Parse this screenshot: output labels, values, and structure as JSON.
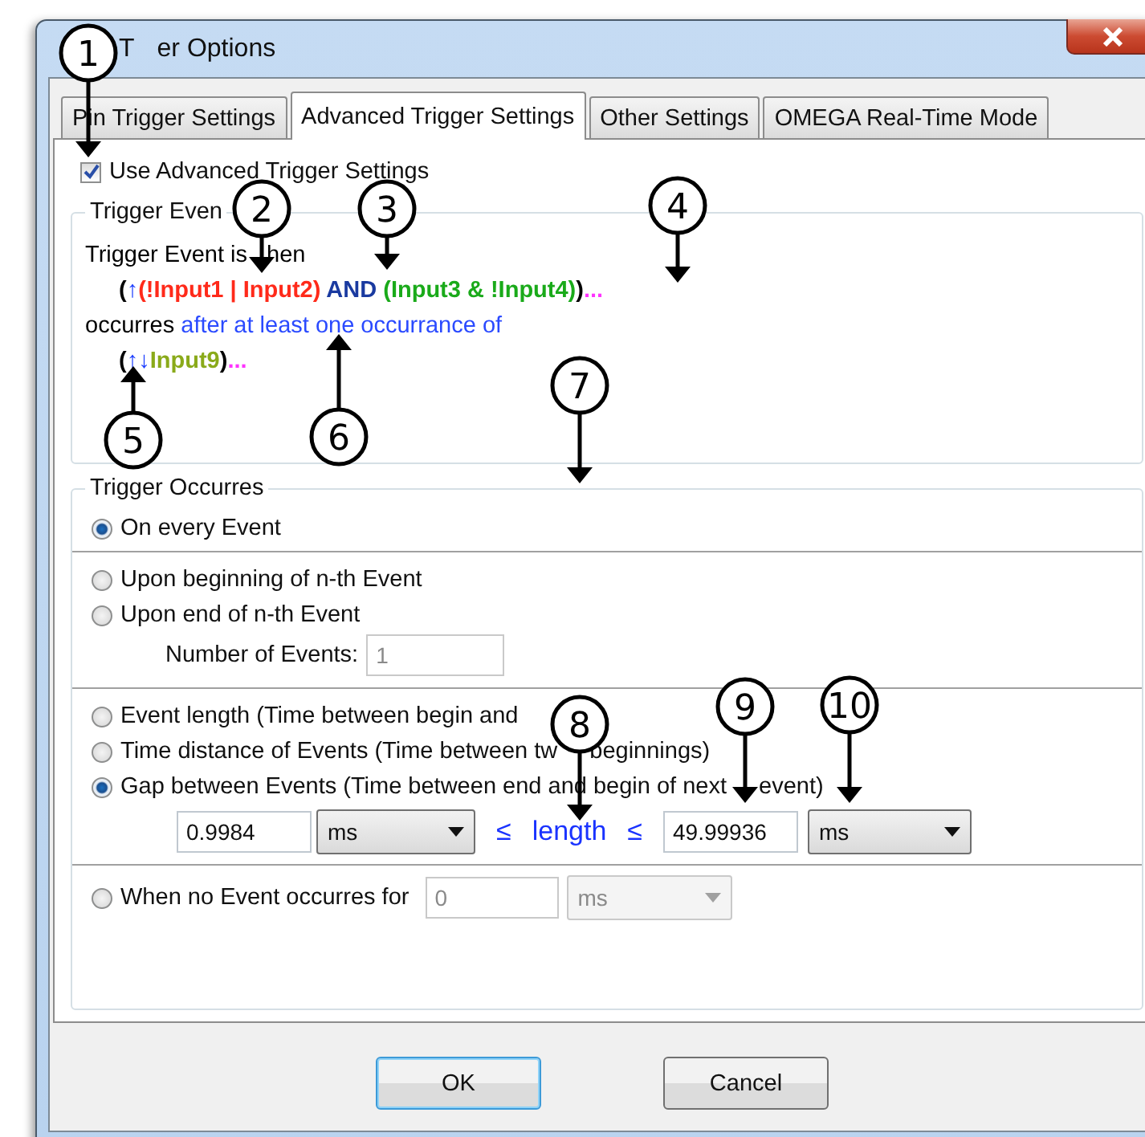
{
  "window": {
    "title_parts": [
      "T",
      "er Options"
    ]
  },
  "tabs": [
    {
      "label": "Pin Trigger Settings",
      "selected": false
    },
    {
      "label": "Advanced Trigger Settings",
      "selected": true
    },
    {
      "label": "Other Settings",
      "selected": false
    },
    {
      "label": "OMEGA Real-Time Mode",
      "selected": false
    }
  ],
  "use_advanced": {
    "label": "Use Advanced Trigger Settings",
    "checked": true
  },
  "trigger_event": {
    "legend": "Trigger Even",
    "lines": [
      {
        "kind": "split",
        "segments": [
          {
            "text": "Trigger Event is",
            "color": "#000000"
          },
          {
            "text": "hen",
            "color": "#000000"
          }
        ]
      },
      {
        "kind": "formula",
        "segments": [
          {
            "text": "(",
            "color": "#000000"
          },
          {
            "text": "↑",
            "color": "#1a3cff"
          },
          {
            "text": "(!Input1 | Input2)",
            "color": "#ff2a1a"
          },
          {
            "text": " AND ",
            "color": "#1a3aa0"
          },
          {
            "text": "(Input3 & !Input4)",
            "color": "#1aaa1a"
          },
          {
            "text": ")",
            "color": "#000000"
          },
          {
            "text": "...",
            "color": "#ff33ff"
          }
        ]
      },
      {
        "kind": "plain",
        "segments": [
          {
            "text": "occurres ",
            "color": "#000000"
          },
          {
            "text": "after at least one occurrance of",
            "color": "#2a4aff"
          }
        ]
      },
      {
        "kind": "formula",
        "segments": [
          {
            "text": "(",
            "color": "#000000"
          },
          {
            "text": "↑↓",
            "color": "#1a3cff"
          },
          {
            "text": "Input9",
            "color": "#8aaa1a"
          },
          {
            "text": ")",
            "color": "#000000"
          },
          {
            "text": "...",
            "color": "#ff33ff"
          }
        ]
      }
    ]
  },
  "trigger_occurres": {
    "legend": "Trigger Occurres",
    "sections": [
      {
        "options": [
          {
            "label": "On every Event",
            "selected": true
          }
        ]
      },
      {
        "options": [
          {
            "label": "Upon beginning of n-th Event",
            "selected": false
          },
          {
            "label": "Upon end of n-th Event",
            "selected": false
          }
        ],
        "count": {
          "label": "Number of Events:",
          "value": "1",
          "disabled": true
        }
      },
      {
        "options": [
          {
            "label": "Event length (Time between begin and",
            "selected": false
          },
          {
            "label_parts": [
              "Time distance of Events (Time between tw",
              "beginnings)"
            ],
            "selected": false
          },
          {
            "label_parts": [
              "Gap between Events (Time between end and begin of next",
              "event)"
            ],
            "selected": true
          }
        ],
        "range": {
          "min": {
            "value": "0.9984",
            "unit": "ms"
          },
          "le_1": "≤",
          "variable": "length",
          "le_2": "≤",
          "max": {
            "value": "49.99936",
            "unit": "ms"
          }
        }
      },
      {
        "options": [
          {
            "label": "When no Event occurres for",
            "selected": false
          }
        ],
        "timeout": {
          "value": "0",
          "unit": "ms",
          "disabled": true
        }
      }
    ]
  },
  "buttons": [
    {
      "label": "OK",
      "default": true
    },
    {
      "label": "Cancel",
      "default": false
    }
  ],
  "callouts": [
    {
      "label": "1"
    },
    {
      "label": "2"
    },
    {
      "label": "3"
    },
    {
      "label": "4"
    },
    {
      "label": "5"
    },
    {
      "label": "6"
    },
    {
      "label": "7"
    },
    {
      "label": "8"
    },
    {
      "label": "9"
    },
    {
      "label": "10"
    }
  ]
}
